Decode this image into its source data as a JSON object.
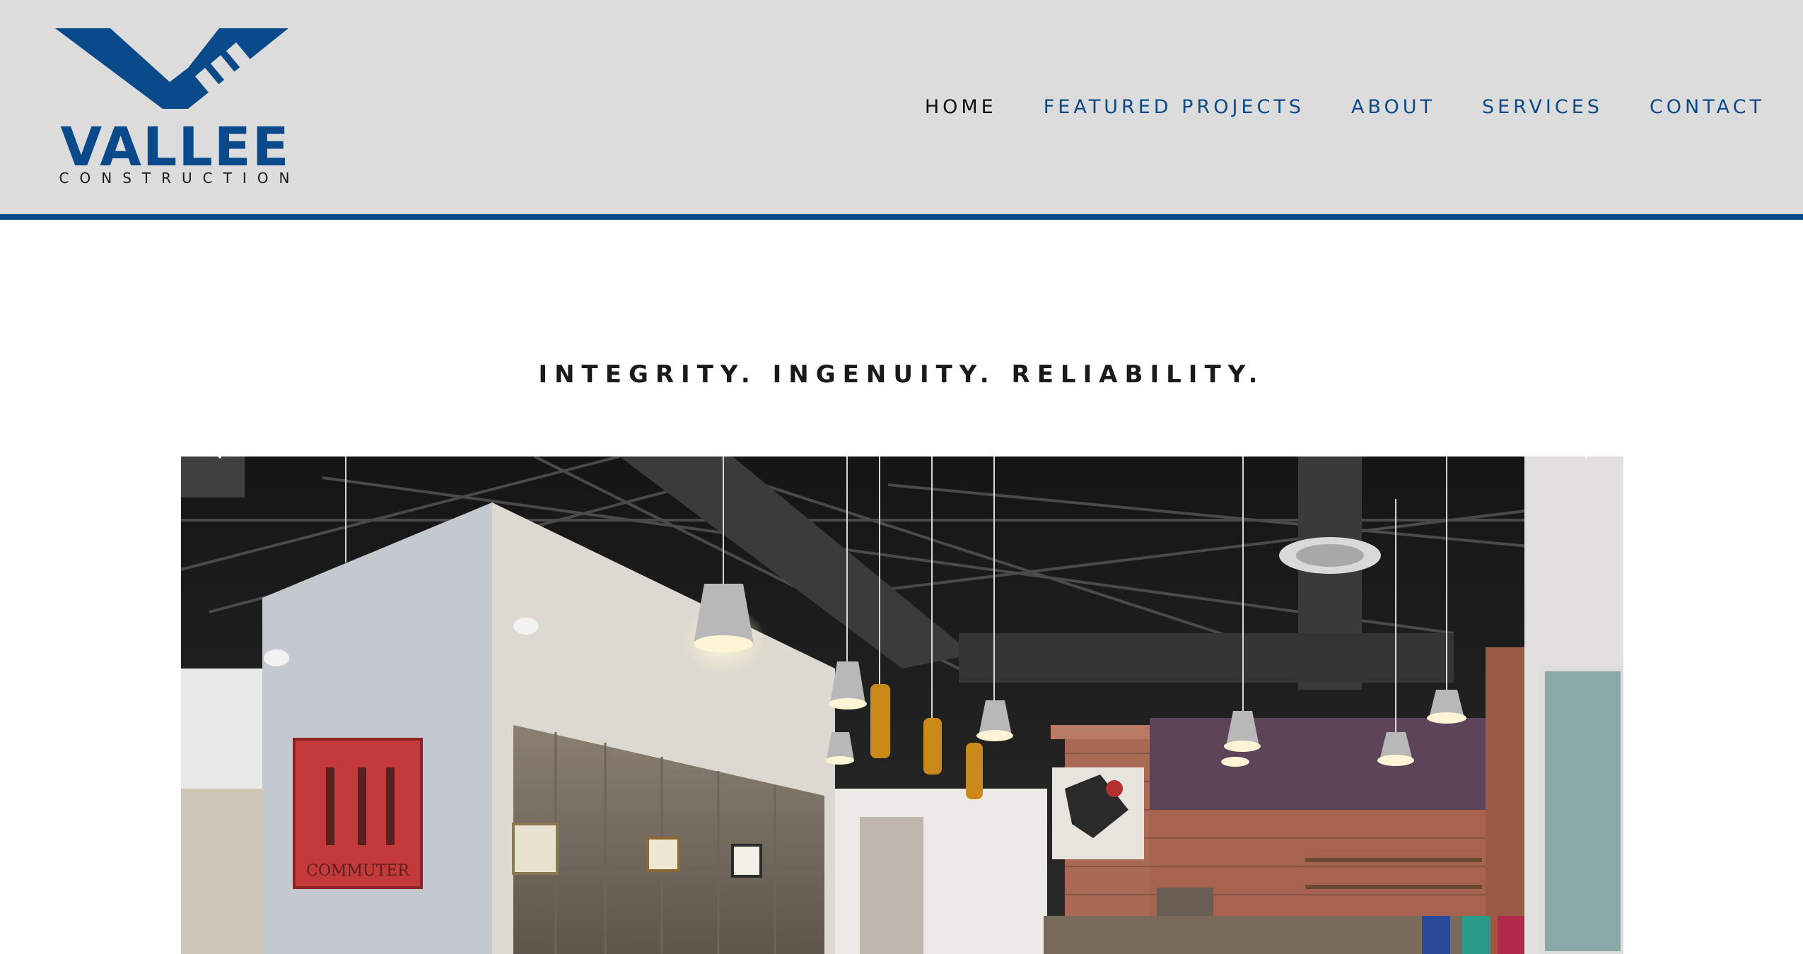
{
  "header": {
    "logo": {
      "word": "VALLEE",
      "sub": "CONSTRUCTION",
      "icon": "vallee-v-logo-icon"
    },
    "nav": [
      {
        "label": "HOME",
        "active": true
      },
      {
        "label": "FEATURED PROJECTS",
        "active": false
      },
      {
        "label": "ABOUT",
        "active": false
      },
      {
        "label": "SERVICES",
        "active": false
      },
      {
        "label": "CONTACT",
        "active": false
      }
    ]
  },
  "main": {
    "tagline": "INTEGRITY. INGENUITY. RELIABILITY.",
    "slideshow": {
      "prev_icon": "chevron-left-icon",
      "next_icon": "chevron-right-icon",
      "sign_text": "COMMUTER"
    }
  },
  "colors": {
    "brand_blue": "#0b4a8a",
    "header_bg": "#dcdcdc",
    "nav_active": "#111111"
  }
}
